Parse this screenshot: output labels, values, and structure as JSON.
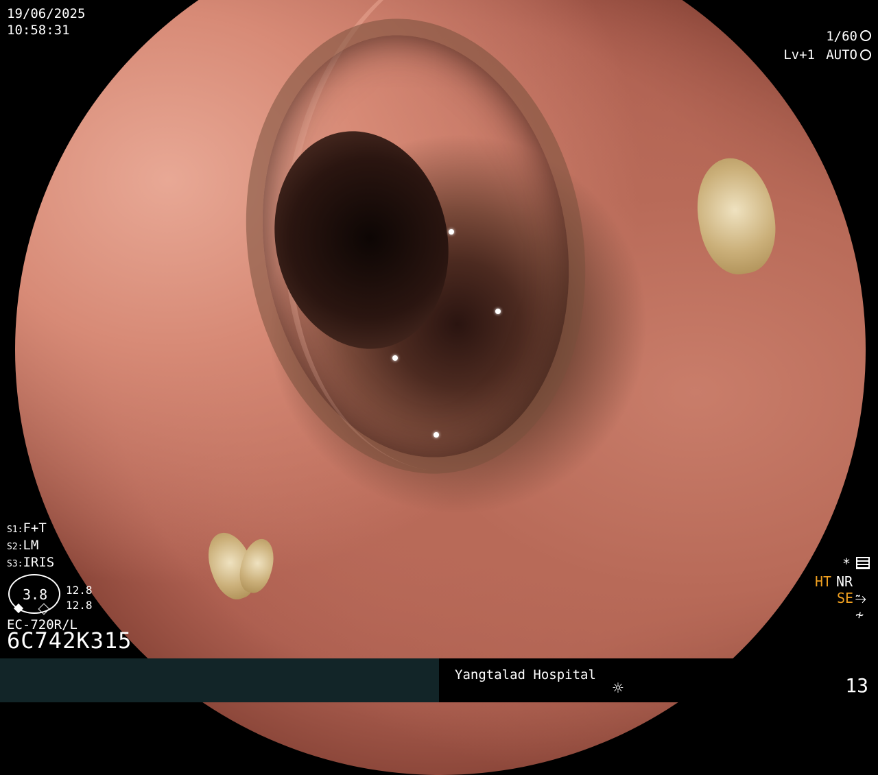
{
  "osd": {
    "date": "19/06/2025",
    "time": "10:58:31",
    "shutter": "1/60",
    "level": "Lv+1",
    "iris_mode": "AUTO",
    "settings": [
      {
        "tag": "S1:",
        "value": "F+T"
      },
      {
        "tag": "S2:",
        "value": "LM"
      },
      {
        "tag": "S3:",
        "value": "IRIS"
      }
    ],
    "gauge_value": "3.8",
    "gauge_right_top": "12.8",
    "gauge_right_bottom": "12.8",
    "scope_model": "EC-720R/L",
    "scope_serial": "6C742K315",
    "asterisk": "*",
    "ht": "HT",
    "nr": "NR",
    "se": "SE",
    "se_symbol": "⥲",
    "curve_symbol": "≁"
  },
  "footer": {
    "hospital": "Yangtalad Hospital",
    "sun_symbol": "☼",
    "image_count": "13"
  },
  "icons": [
    "shutter-icon",
    "auto-iris-icon",
    "gauge-icon",
    "settings-icon",
    "sun-icon"
  ],
  "colors": {
    "accent_orange": "#f0a020",
    "footer_bar": "#122528",
    "background": "#000000"
  }
}
